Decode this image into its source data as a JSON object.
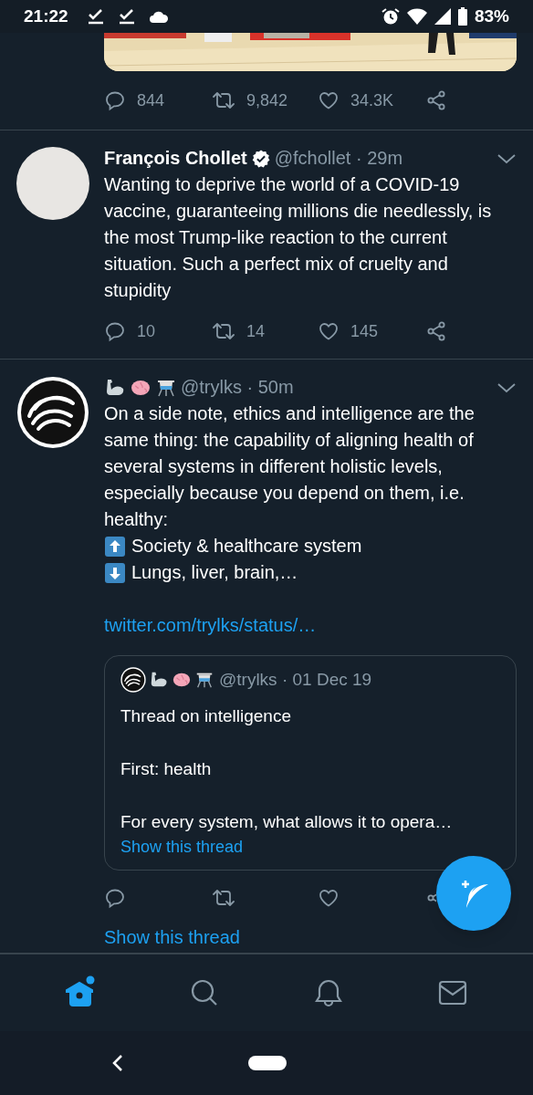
{
  "status_bar": {
    "time": "21:22",
    "battery": "83%"
  },
  "feed": [
    {
      "kind": "media_tail",
      "actions": {
        "replies": "844",
        "retweets": "9,842",
        "likes": "34.3K"
      }
    },
    {
      "kind": "tweet",
      "avatar": {
        "kind": "plain"
      },
      "name": "François Chollet",
      "verified": true,
      "byline": "@fchollet · 29m",
      "body": [
        {
          "kind": "text",
          "text": "Wanting to deprive the world of a COVID-19 vaccine, guaranteeing millions die needlessly, is the most Trump-like reaction to the current situation. Such a perfect mix of cruelty and stupidity"
        }
      ],
      "actions": {
        "replies": "10",
        "retweets": "14",
        "likes": "145"
      }
    },
    {
      "kind": "tweet",
      "avatar": {
        "kind": "swirl"
      },
      "emoji_name": true,
      "byline": "@trylks · 50m",
      "body": [
        {
          "kind": "text",
          "text": "On a side note, ethics and intelligence are the same thing: the capability of aligning health of several systems in different holistic levels, especially because you depend on them, i.e. healthy:"
        },
        {
          "kind": "up",
          "text": "Society & healthcare system"
        },
        {
          "kind": "down",
          "text": "Lungs, liver, brain,…"
        },
        {
          "kind": "gap"
        },
        {
          "kind": "link",
          "text": "twitter.com/trylks/status/…"
        }
      ],
      "quote": {
        "byline": "@trylks · 01 Dec 19",
        "lines": [
          "Thread on intelligence",
          "First: health",
          "For every system, what allows it to opera…"
        ],
        "link": "Show this thread"
      },
      "show_thread": "Show this thread"
    }
  ],
  "nav": [
    {
      "kind": "home",
      "selected": true,
      "dot": true
    },
    {
      "kind": "search",
      "selected": false,
      "dot": false
    },
    {
      "kind": "notifications",
      "selected": false,
      "dot": false
    },
    {
      "kind": "messages",
      "selected": false,
      "dot": false
    }
  ]
}
